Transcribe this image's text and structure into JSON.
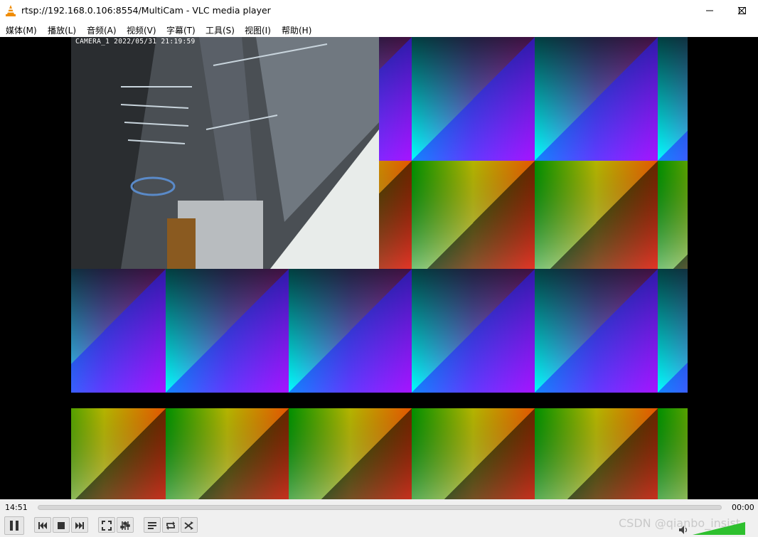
{
  "window": {
    "title": "rtsp://192.168.0.106:8554/MultiCam - VLC media player",
    "app_icon": "vlc-cone-icon",
    "buttons": [
      "minimize-icon",
      "maximize-icon",
      "close-icon"
    ]
  },
  "menu": {
    "items": [
      "媒体(M)",
      "播放(L)",
      "音频(A)",
      "视频(V)",
      "字幕(T)",
      "工具(S)",
      "视图(I)",
      "帮助(H)"
    ]
  },
  "video": {
    "camera_overlay": "CAMERA_1 2022/05/31 21:19:59"
  },
  "controls": {
    "elapsed": "14:51",
    "remaining": "00:00",
    "buttons": [
      "pause-icon",
      "previous-icon",
      "stop-icon",
      "next-icon",
      "fullscreen-icon",
      "extended-settings-icon",
      "playlist-icon",
      "loop-icon",
      "shuffle-icon"
    ],
    "volume_icon": "speaker-icon",
    "volume_level": 1.0
  },
  "watermark": "CSDN @qianbo_insist"
}
